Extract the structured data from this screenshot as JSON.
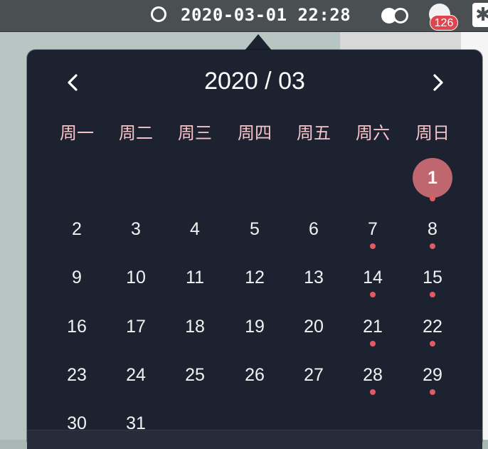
{
  "menubar": {
    "datetime": "2020-03-01 22:28",
    "notification_count": "126",
    "icons": [
      "clock-icon",
      "toggle-icon",
      "app-icon",
      "asterisk-icon"
    ]
  },
  "calendar": {
    "title": "2020 / 03",
    "prev_icon": "chevron-left-icon",
    "next_icon": "chevron-right-icon",
    "weekdays": [
      "周一",
      "周二",
      "周三",
      "周四",
      "周五",
      "周六",
      "周日"
    ],
    "weeks": [
      [
        "",
        "",
        "",
        "",
        "",
        "",
        "1"
      ],
      [
        "2",
        "3",
        "4",
        "5",
        "6",
        "7",
        "8"
      ],
      [
        "9",
        "10",
        "11",
        "12",
        "13",
        "14",
        "15"
      ],
      [
        "16",
        "17",
        "18",
        "19",
        "20",
        "21",
        "22"
      ],
      [
        "23",
        "24",
        "25",
        "26",
        "27",
        "28",
        "29"
      ],
      [
        "30",
        "31",
        "",
        "",
        "",
        "",
        ""
      ]
    ],
    "today": "1",
    "event_days": [
      "1",
      "7",
      "8",
      "14",
      "15",
      "21",
      "22",
      "28",
      "29"
    ],
    "colors": {
      "background": "#1c2230",
      "weekday_text": "#f4c4c9",
      "today_circle": "#c0666f",
      "event_dot": "#e35a63",
      "badge": "#e0454f"
    }
  }
}
